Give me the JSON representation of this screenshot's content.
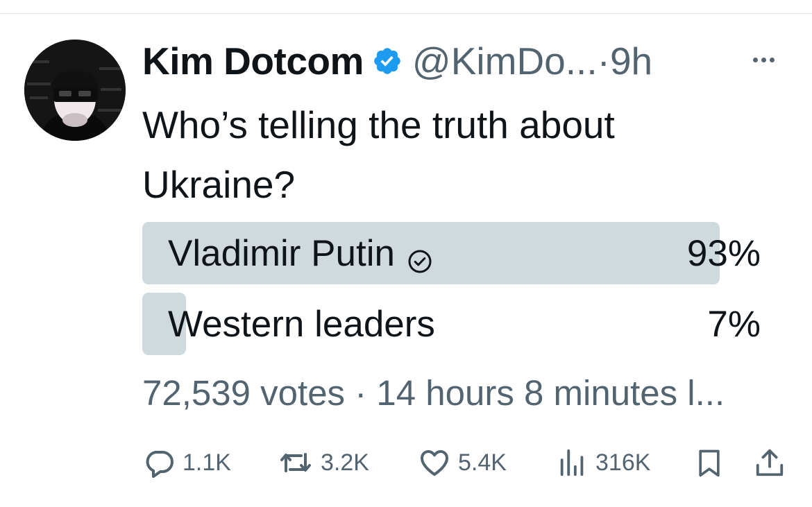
{
  "tweet": {
    "author_name": "Kim Dotcom",
    "handle": "@KimDo...",
    "separator": "·",
    "time": "9h",
    "text_line1": "Who’s telling the truth about",
    "text_line2": "Ukraine?",
    "verified_color": "#1d9bf0"
  },
  "poll": {
    "options": [
      {
        "label": "Vladimir Putin",
        "percent_text": "93%",
        "percent": 93,
        "winner": true
      },
      {
        "label": "Western leaders",
        "percent_text": "7%",
        "percent": 7,
        "winner": false
      }
    ],
    "meta": "72,539 votes · 14 hours 8 minutes l...",
    "bar_color": "#cfd9de"
  },
  "actions": {
    "replies": "1.1K",
    "reposts": "3.2K",
    "likes": "5.4K",
    "views": "316K"
  },
  "icons": [
    "more-icon",
    "verified-badge-icon",
    "check-circle-icon",
    "reply-icon",
    "repost-icon",
    "like-icon",
    "views-icon",
    "bookmark-icon",
    "share-icon"
  ],
  "colors": {
    "text": "#0f1419",
    "secondary": "#536471",
    "accent": "#1d9bf0"
  }
}
